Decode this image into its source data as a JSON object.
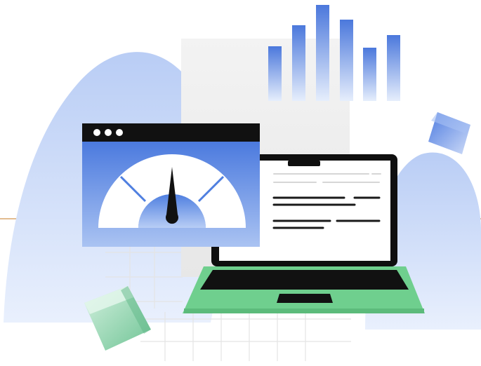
{
  "illustration": {
    "subject": "performance-dashboard-illustration",
    "gauge": {
      "level": 0.5
    },
    "bars": {
      "values": [
        0.55,
        0.82,
        1.0,
        0.88,
        0.58,
        0.72
      ]
    },
    "window_dots": 3,
    "icons": [
      "gauge-icon",
      "bar-chart-icon",
      "laptop-icon",
      "browser-window-icon",
      "cube-icon"
    ],
    "colors": {
      "accent_blue": "#4f7fe0",
      "light_blue": "#c9d8f7",
      "window_bar": "#111111",
      "laptop_green": "#6fcf8e",
      "cube_green": "#a8e0bf",
      "line_orange": "#d9a66b",
      "grid": "#e4e4e4"
    }
  }
}
